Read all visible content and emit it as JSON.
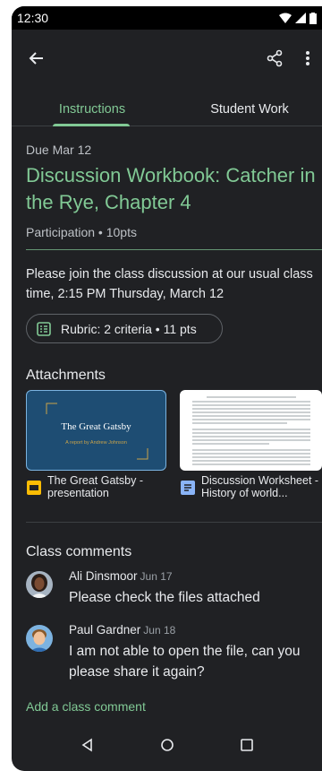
{
  "status_bar": {
    "time": "12:30"
  },
  "tabs": {
    "instructions": "Instructions",
    "student_work": "Student Work"
  },
  "assignment": {
    "due": "Due Mar 12",
    "title": "Discussion Workbook: Catcher in the Rye, Chapter 4",
    "points": "Participation • 10pts",
    "description": "Please join the class discussion at our usual class time, 2:15 PM Thursday, March 12",
    "rubric": "Rubric: 2 criteria • 11 pts"
  },
  "attachments": {
    "heading": "Attachments",
    "items": [
      {
        "name": "The Great Gatsby - presentation",
        "icon": "slides-icon",
        "thumb_title": "The Great Gatsby",
        "thumb_subtitle": "A report by Andrew Johnson"
      },
      {
        "name": "Discussion Worksheet - History of world...",
        "icon": "docs-icon"
      }
    ]
  },
  "comments": {
    "heading": "Class comments",
    "items": [
      {
        "author": "Ali Dinsmoor",
        "date": "Jun 17",
        "text": "Please check the files attached"
      },
      {
        "author": "Paul Gardner",
        "date": "Jun 18",
        "text": "I am not able to open the file, can you please share it again?"
      }
    ],
    "add_label": "Add a class comment"
  },
  "colors": {
    "accent": "#81c995",
    "background": "#202124",
    "slide_bg": "#1e4d73"
  }
}
